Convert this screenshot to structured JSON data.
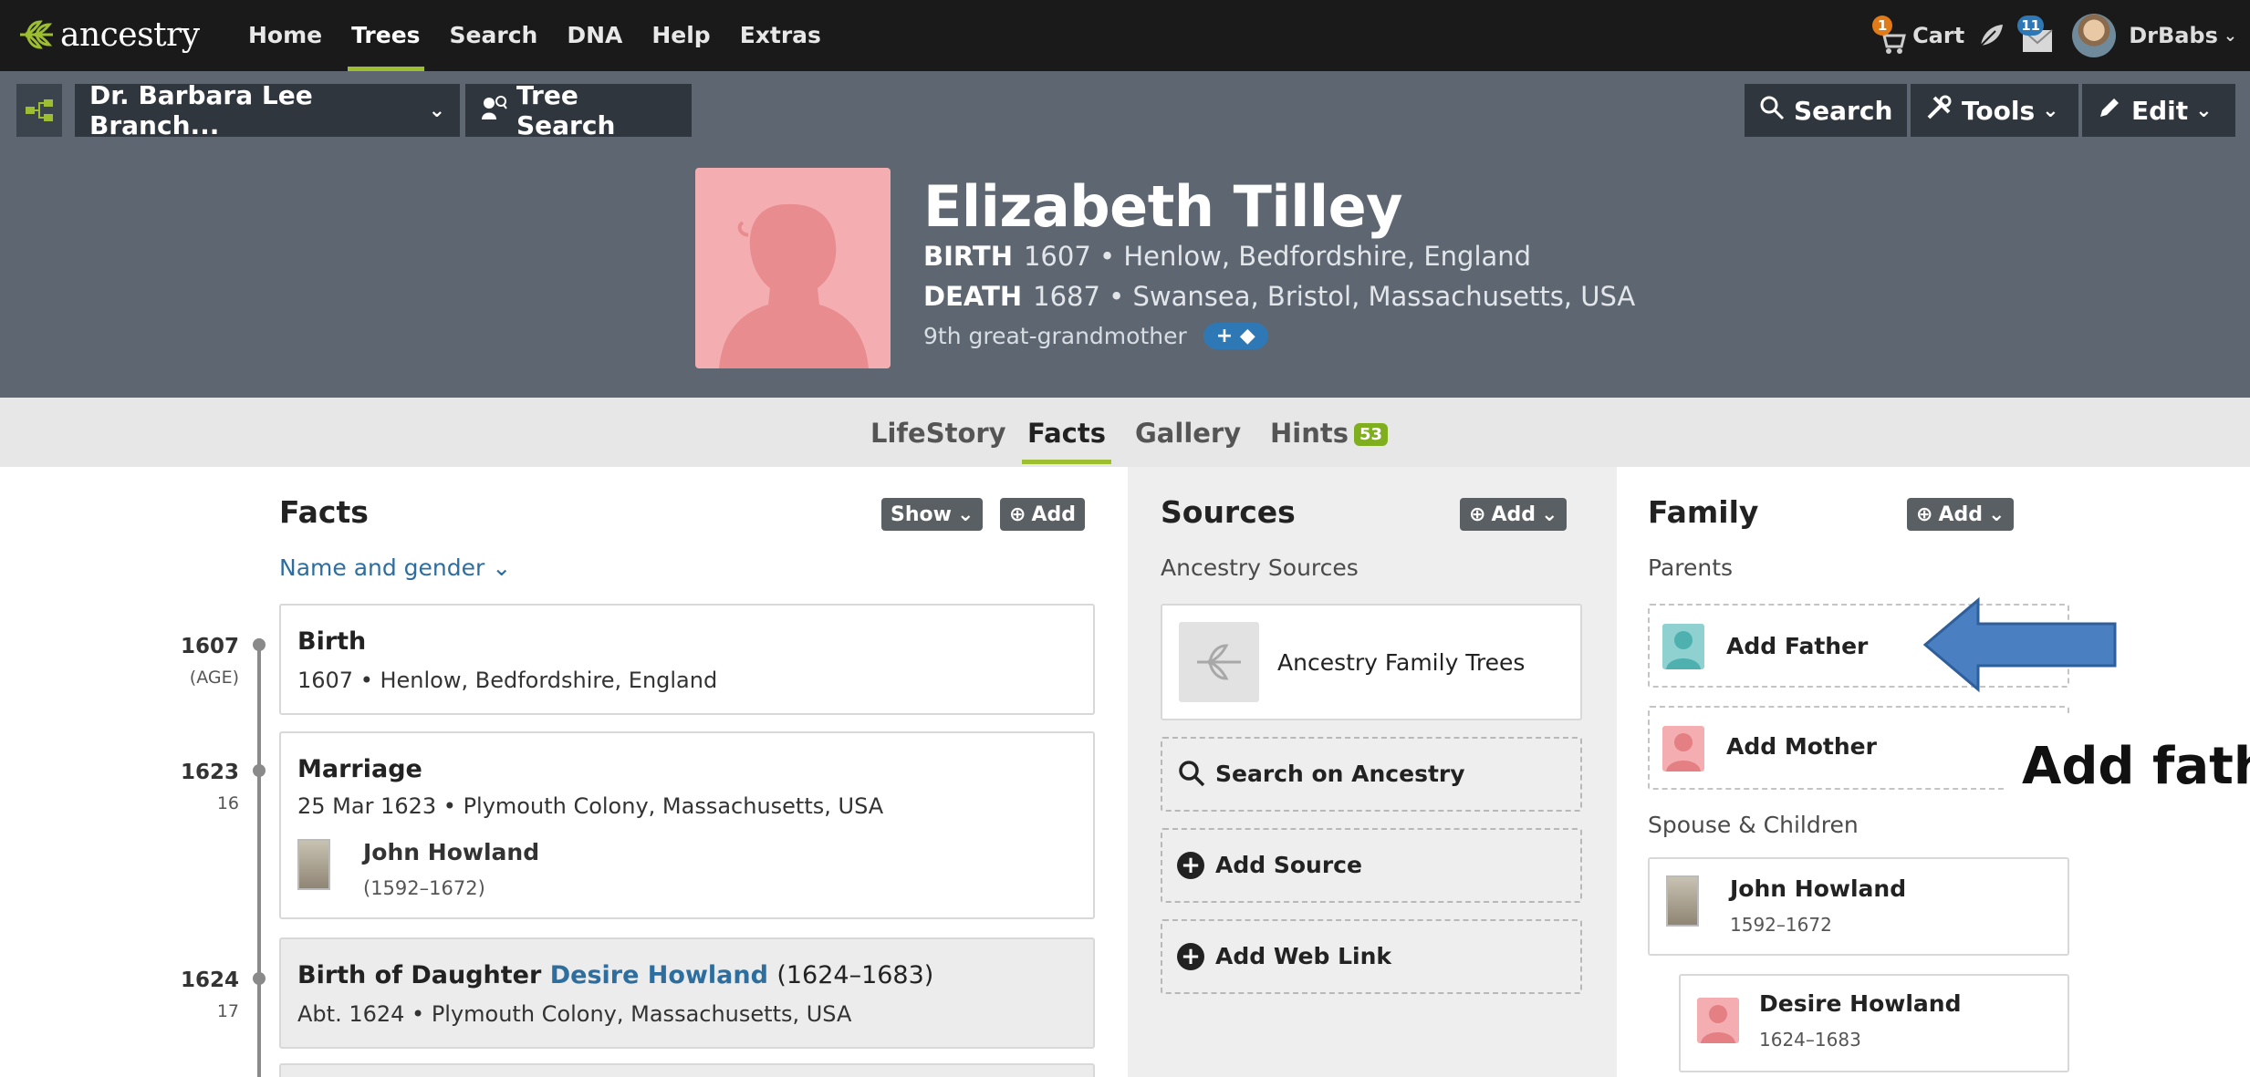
{
  "topnav": {
    "logo_text": "ancestry",
    "links": [
      "Home",
      "Trees",
      "Search",
      "DNA",
      "Help",
      "Extras"
    ],
    "active_link": "Trees",
    "cart_label": "Cart",
    "cart_count": "1",
    "messages_count": "11",
    "username": "DrBabs",
    "icons": [
      "ancestry-leaf-logo",
      "cart-icon",
      "leaf-icon",
      "messages-icon",
      "avatar"
    ]
  },
  "toolbar": {
    "tree_name": "Dr. Barbara Lee Branch...",
    "tree_search_label": "Tree Search",
    "search_label": "Search",
    "tools_label": "Tools",
    "edit_label": "Edit"
  },
  "person": {
    "name": "Elizabeth Tilley",
    "birth_label": "BIRTH",
    "birth_value": "1607 • Henlow, Bedfordshire, England",
    "death_label": "DEATH",
    "death_value": "1687 • Swansea, Bristol, Massachusetts, USA",
    "relationship": "9th great-grandmother",
    "tag_button": "+"
  },
  "tabs": [
    {
      "label": "LifeStory"
    },
    {
      "label": "Facts"
    },
    {
      "label": "Gallery"
    },
    {
      "label": "Hints"
    }
  ],
  "active_tab": "Facts",
  "hints_count": "53",
  "facts": {
    "title": "Facts",
    "show_label": "Show",
    "add_label": "Add",
    "name_gender_link": "Name and gender",
    "events": [
      {
        "year": "1607",
        "age": "(AGE)",
        "title": "Birth",
        "detail": "1607 • Henlow, Bedfordshire, England"
      },
      {
        "year": "1623",
        "age": "16",
        "title": "Marriage",
        "detail": "25 Mar 1623 • Plymouth Colony, Massachusetts, USA",
        "spouse_name": "John Howland",
        "spouse_years": "(1592–1672)"
      },
      {
        "year": "1624",
        "age": "17",
        "title_prefix": "Birth of Daughter",
        "title_link": "Desire Howland",
        "title_suffix": "(1624–1683)",
        "detail": "Abt. 1624 • Plymouth Colony, Massachusetts, USA"
      }
    ]
  },
  "sources": {
    "title": "Sources",
    "add_label": "Add",
    "subhead": "Ancestry Sources",
    "family_trees_label": "Ancestry Family Trees",
    "search_label": "Search on Ancestry",
    "add_source_label": "Add Source",
    "add_web_link_label": "Add Web Link"
  },
  "family": {
    "title": "Family",
    "add_label": "Add",
    "parents_label": "Parents",
    "add_father": "Add Father",
    "add_mother": "Add Mother",
    "spouse_children_label": "Spouse & Children",
    "spouse_name": "John Howland",
    "spouse_years": "1592–1672",
    "child_name": "Desire Howland",
    "child_years": "1624–1683"
  },
  "annotation": {
    "text": "Add fath"
  },
  "colors": {
    "topnav_bg": "#1a1a1a",
    "header_bg": "#5e6771",
    "accent_green": "#9cbe30",
    "link_blue": "#2d6e9e",
    "female_pink": "#f4aeb1",
    "male_teal": "#8fd0d0",
    "arrow_blue": "#4a7fc1"
  }
}
